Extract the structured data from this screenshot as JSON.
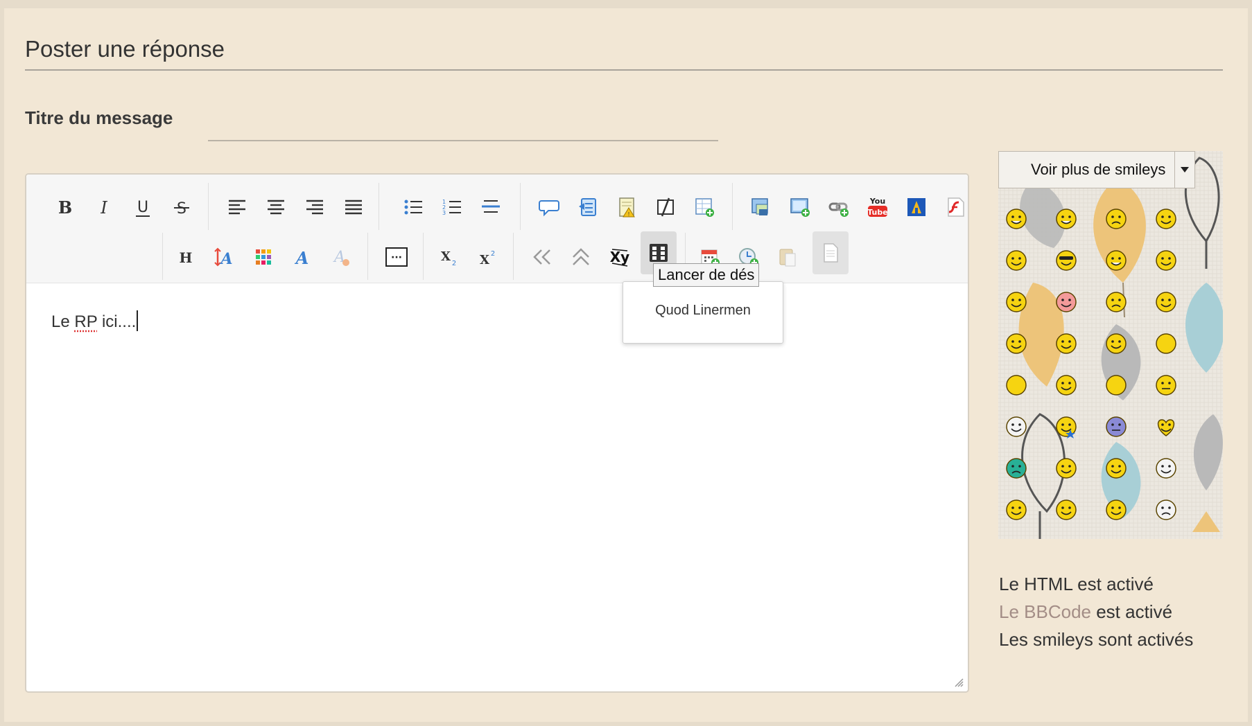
{
  "form": {
    "section_title": "Poster une réponse",
    "subject_label": "Titre du message",
    "subject_value": ""
  },
  "toolbar": {
    "row1": [
      "bold-icon",
      "italic-icon",
      "underline-icon",
      "strikethrough-icon",
      "align-left-icon",
      "align-center-icon",
      "align-right-icon",
      "align-justify-icon",
      "bullet-list-icon",
      "numbered-list-icon",
      "horizontal-rule-icon",
      "quote-icon",
      "code-icon",
      "spoiler-icon",
      "hide-icon",
      "table-icon",
      "image-icon",
      "host-image-icon",
      "link-icon",
      "youtube-icon",
      "dailymotion-icon",
      "flash-icon"
    ],
    "row2": [
      "heading-icon",
      "font-size-icon",
      "color-icon",
      "font-face-icon",
      "clear-format-icon",
      "more-icon",
      "subscript-icon",
      "superscript-icon",
      "previous-icon",
      "up-icon",
      "text-transform-icon",
      "dice-icon",
      "calendar-icon",
      "clock-icon",
      "paste-icon",
      "source-icon"
    ],
    "youtube_text": [
      "You",
      "Tube"
    ],
    "bold_letter": "B",
    "italic_letter": "I",
    "underline_letter": "U",
    "strike_letter": "S",
    "heading_letter": "H",
    "font_letter": "A",
    "sub_letter": "X",
    "sub_index": "2",
    "sup_index": "2",
    "xy_label": "Xy",
    "more_dots": "···"
  },
  "editor": {
    "text_before": "Le ",
    "text_misspelled": "RP",
    "text_after": " ici...."
  },
  "dice_menu": {
    "tooltip": "Lancer de dés",
    "items": [
      "Quod Linermen"
    ]
  },
  "smileys": {
    "select_label": "Voir plus de smileys",
    "colors": {
      "yellow": "#f6d411",
      "outline": "#5a4400",
      "teal": "#28b096",
      "pink": "#f49a9a",
      "blue": "#8a8ad6"
    }
  },
  "status": {
    "html": "Le HTML est activé",
    "bbcode_link": "Le BBCode",
    "bbcode_rest": " est activé",
    "smileys": "Les smileys sont activés"
  }
}
